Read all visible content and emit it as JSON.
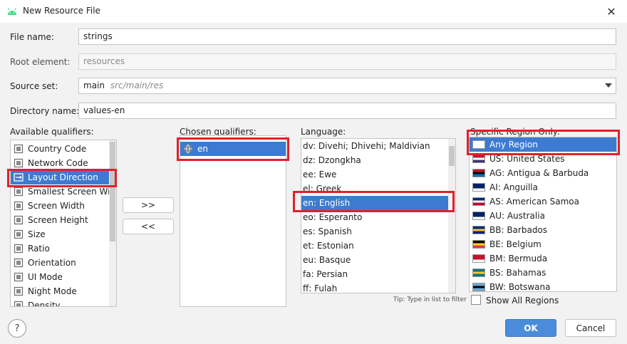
{
  "window": {
    "title": "New Resource File",
    "close_glyph": "✕"
  },
  "form": {
    "file_name_label": "File name:",
    "file_name_value": "strings",
    "root_element_label": "Root element:",
    "root_element_value": "resources",
    "source_set_label": "Source set:",
    "source_set_value": "main",
    "source_set_path": "src/main/res",
    "directory_name_label": "Directory name:",
    "directory_name_value": "values-en"
  },
  "available": {
    "label": "Available qualifiers:",
    "items": [
      {
        "label": "Country Code",
        "icon": "country-code-icon"
      },
      {
        "label": "Network Code",
        "icon": "network-code-icon"
      },
      {
        "label": "Layout Direction",
        "icon": "layout-direction-icon",
        "selected": true
      },
      {
        "label": "Smallest Screen Wi...",
        "icon": "smallest-screen-icon"
      },
      {
        "label": "Screen Width",
        "icon": "screen-width-icon"
      },
      {
        "label": "Screen Height",
        "icon": "screen-height-icon"
      },
      {
        "label": "Size",
        "icon": "size-icon"
      },
      {
        "label": "Ratio",
        "icon": "ratio-icon"
      },
      {
        "label": "Orientation",
        "icon": "orientation-icon"
      },
      {
        "label": "UI Mode",
        "icon": "ui-mode-icon"
      },
      {
        "label": "Night Mode",
        "icon": "night-mode-icon"
      },
      {
        "label": "Density",
        "icon": "density-icon"
      }
    ]
  },
  "move": {
    "add_label": ">>",
    "remove_label": "<<"
  },
  "chosen": {
    "label": "Chosen qualifiers:",
    "items": [
      {
        "label": "en",
        "icon": "globe-icon",
        "selected": true
      }
    ]
  },
  "language": {
    "label": "Language:",
    "items": [
      {
        "label": "dv: Divehi; Dhivehi; Maldivian"
      },
      {
        "label": "dz: Dzongkha"
      },
      {
        "label": "ee: Ewe"
      },
      {
        "label": "el: Greek"
      },
      {
        "label": "en: English",
        "selected": true
      },
      {
        "label": "eo: Esperanto"
      },
      {
        "label": "es: Spanish"
      },
      {
        "label": "et: Estonian"
      },
      {
        "label": "eu: Basque"
      },
      {
        "label": "fa: Persian"
      },
      {
        "label": "ff: Fulah"
      }
    ],
    "tip": "Tip: Type in list to filter"
  },
  "region": {
    "label": "Specific Region Only:",
    "items": [
      {
        "label": "Any Region",
        "selected": true,
        "flag": [
          "#ffffff",
          "#ffffff",
          "#ffffff"
        ]
      },
      {
        "label": "US: United States",
        "flag": [
          "#b22234",
          "#ffffff",
          "#3c3b6e"
        ]
      },
      {
        "label": "AG: Antigua & Barbuda",
        "flag": [
          "#ce1126",
          "#000000",
          "#0072c6"
        ]
      },
      {
        "label": "AI: Anguilla",
        "flag": [
          "#012169",
          "#012169",
          "#ffffff"
        ]
      },
      {
        "label": "AS: American Samoa",
        "flag": [
          "#002b7f",
          "#ffffff",
          "#bf0a30"
        ]
      },
      {
        "label": "AU: Australia",
        "flag": [
          "#012169",
          "#012169",
          "#ffffff"
        ]
      },
      {
        "label": "BB: Barbados",
        "flag": [
          "#00267f",
          "#ffc726",
          "#00267f"
        ]
      },
      {
        "label": "BE: Belgium",
        "flag": [
          "#000000",
          "#fdda24",
          "#ef3340"
        ]
      },
      {
        "label": "BM: Bermuda",
        "flag": [
          "#c8102e",
          "#c8102e",
          "#ffffff"
        ]
      },
      {
        "label": "BS: Bahamas",
        "flag": [
          "#00778b",
          "#ffc72c",
          "#00778b"
        ]
      },
      {
        "label": "BW: Botswana",
        "flag": [
          "#6da9d2",
          "#000000",
          "#6da9d2"
        ]
      }
    ],
    "show_all_label": "Show All Regions"
  },
  "footer": {
    "help_glyph": "?",
    "ok_label": "OK",
    "cancel_label": "Cancel"
  },
  "colors": {
    "selection": "#3d7bd1",
    "highlight_box": "#e0202a",
    "primary_button": "#4a8cd9"
  }
}
